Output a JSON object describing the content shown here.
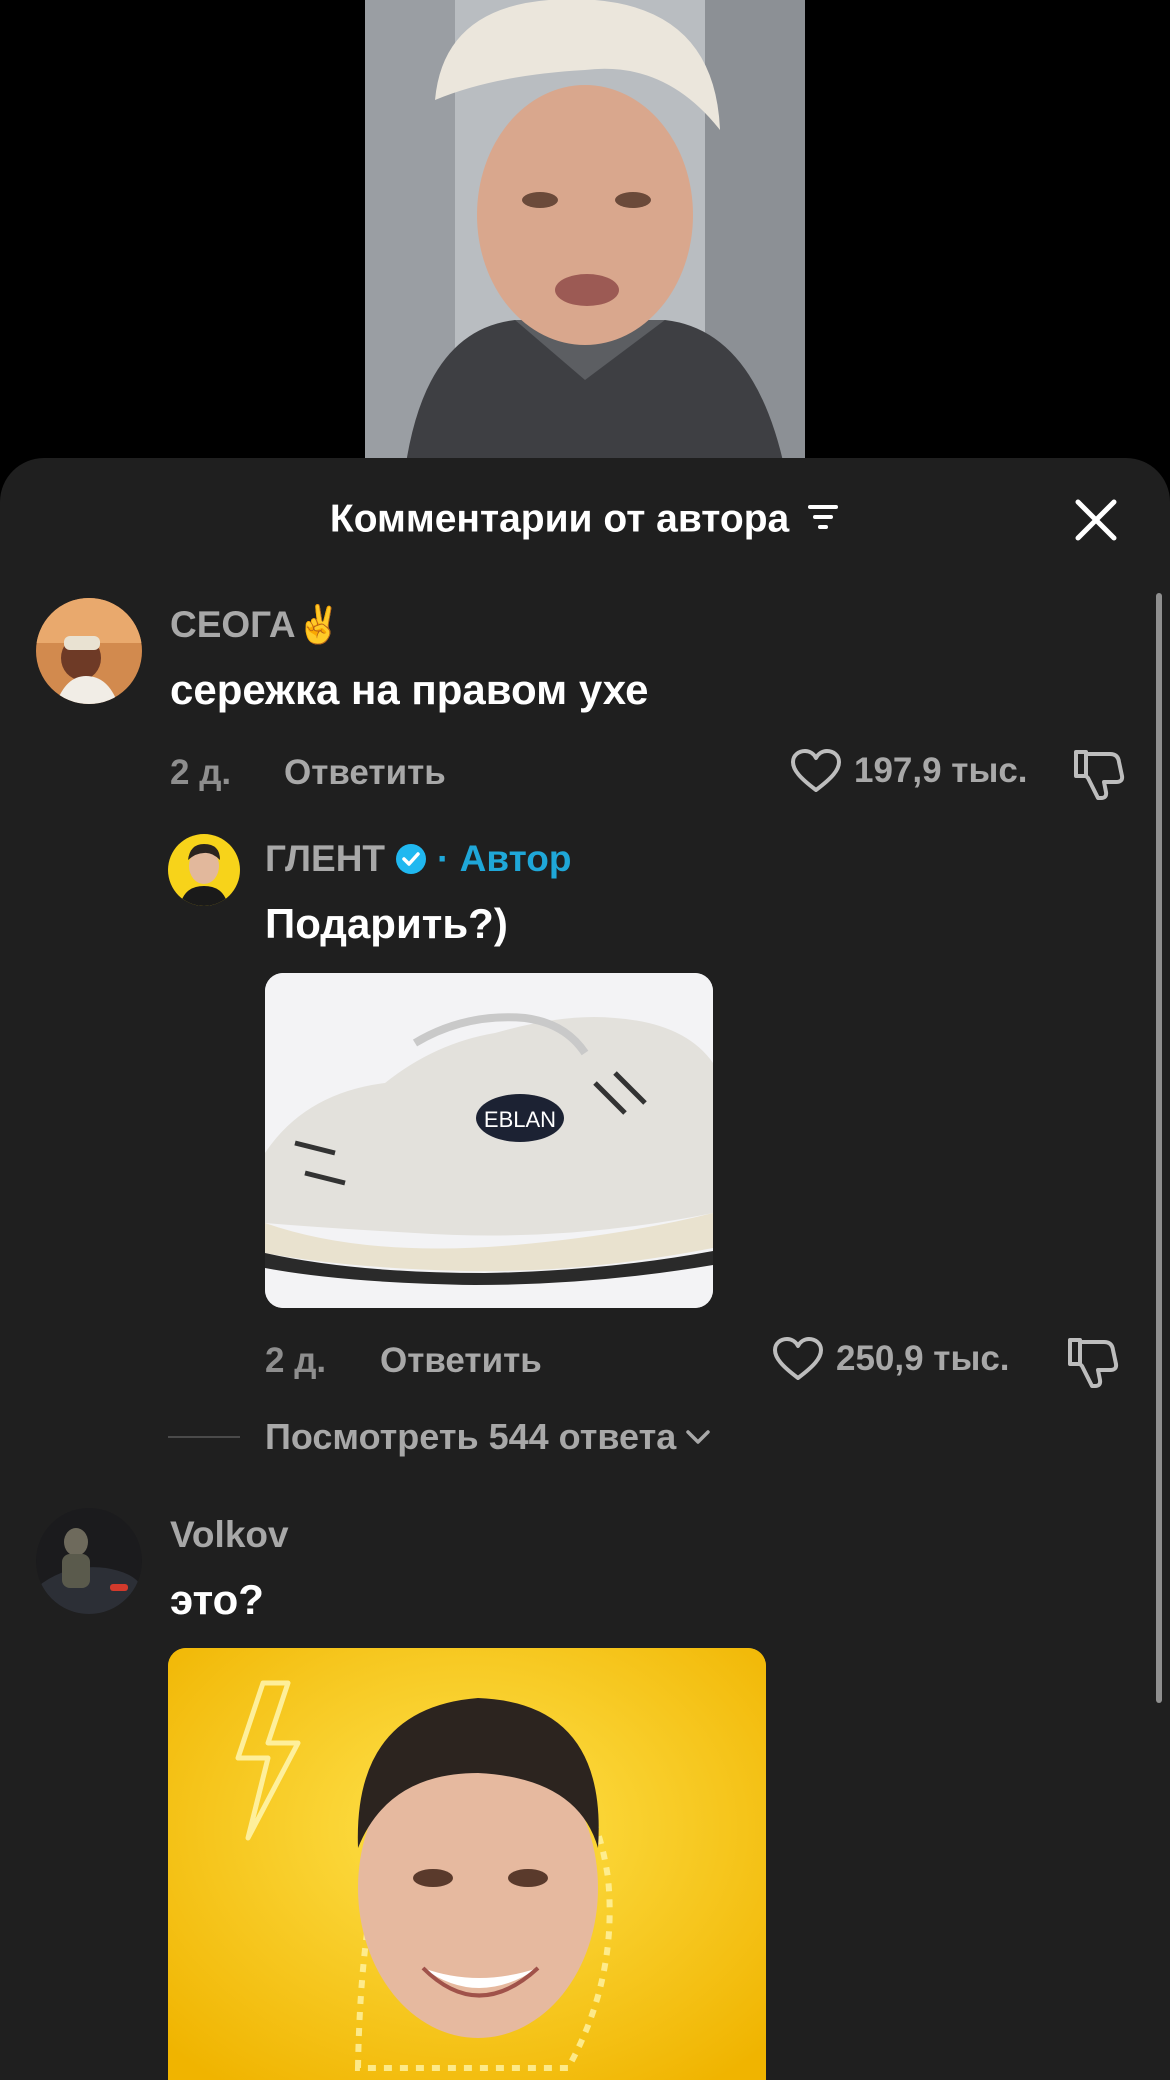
{
  "sheet": {
    "title": "Комментарии от автора"
  },
  "comments": [
    {
      "user": "СЕОГА✌️",
      "text": "сережка на правом ухе",
      "time": "2 д.",
      "reply_label": "Ответить",
      "likes": "197,9 тыс."
    },
    {
      "user": "ГЛЕНТ",
      "badge": "· Автор",
      "text": "Подарить?)",
      "image_text": "EBLAN",
      "time": "2 д.",
      "reply_label": "Ответить",
      "likes": "250,9 тыс."
    },
    {
      "user": "Volkov",
      "text": "это?"
    }
  ],
  "view_replies": "Посмотреть 544 ответа",
  "colors": {
    "author_badge": "#1fa7d8",
    "verified": "#20b8f0",
    "sheet_bg": "#1f1f1f"
  }
}
